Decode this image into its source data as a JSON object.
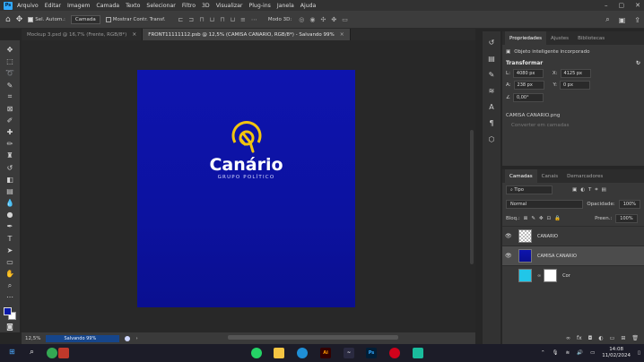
{
  "menu": {
    "app_abbr": "Ps",
    "items": [
      "Arquivo",
      "Editar",
      "Imagem",
      "Camada",
      "Texto",
      "Selecionar",
      "Filtro",
      "3D",
      "Visualizar",
      "Plug-ins",
      "Janela",
      "Ajuda"
    ]
  },
  "options": {
    "auto_select_label": "Sel. Autom.:",
    "auto_select_value": "Camada",
    "show_transform_label": "Mostrar Contr. Transf.",
    "mode_3d_label": "Modo 3D:"
  },
  "tabs": [
    {
      "label": "Mockup 3.psd @ 16,7% (Frente, RGB/8*)",
      "active": false
    },
    {
      "label": "FRONT11111112.psb @ 12,5% (CAMISA CANARIO, RGB/8*) - Salvando 99%",
      "active": true
    }
  ],
  "artboard": {
    "brand_name": "Canário",
    "brand_subtitle": "GRUPO POLÍTICO",
    "background_color": "#0e14ae",
    "logo_color": "#f1c40f"
  },
  "status": {
    "zoom": "12,5%",
    "progress_text": "Salvando 99%",
    "progress_percent": 99
  },
  "properties": {
    "tabs": [
      "Propriedades",
      "Ajustes",
      "Bibliotecas"
    ],
    "object_type": "Objeto inteligente incorporado",
    "transform_label": "Transformar",
    "width": "4080 px",
    "x": "4125 px",
    "height": "238 px",
    "y": "0 px",
    "angle": "0,00°",
    "linked_file": "CAMISA CANARIO.png",
    "convert_hint": "Converter em camadas"
  },
  "layers_panel": {
    "tabs": [
      "Camadas",
      "Canais",
      "Demarcadores"
    ],
    "filter_label": "Tipo",
    "blend_mode": "Normal",
    "opacity_label": "Opacidade:",
    "opacity_value": "100%",
    "lock_label": "Bloq.:",
    "fill_label": "Preen.:",
    "fill_value": "100%",
    "layers": [
      {
        "name": "CANARIO",
        "thumb": "checker",
        "visible": true,
        "selected": false
      },
      {
        "name": "CAMISA CANARIO",
        "thumb": "blue",
        "visible": true,
        "selected": true
      },
      {
        "name": "Cor",
        "thumb": "cyan",
        "visible": false,
        "selected": false
      }
    ]
  },
  "taskbar": {
    "time": "14:08",
    "date": "11/02/2024"
  }
}
